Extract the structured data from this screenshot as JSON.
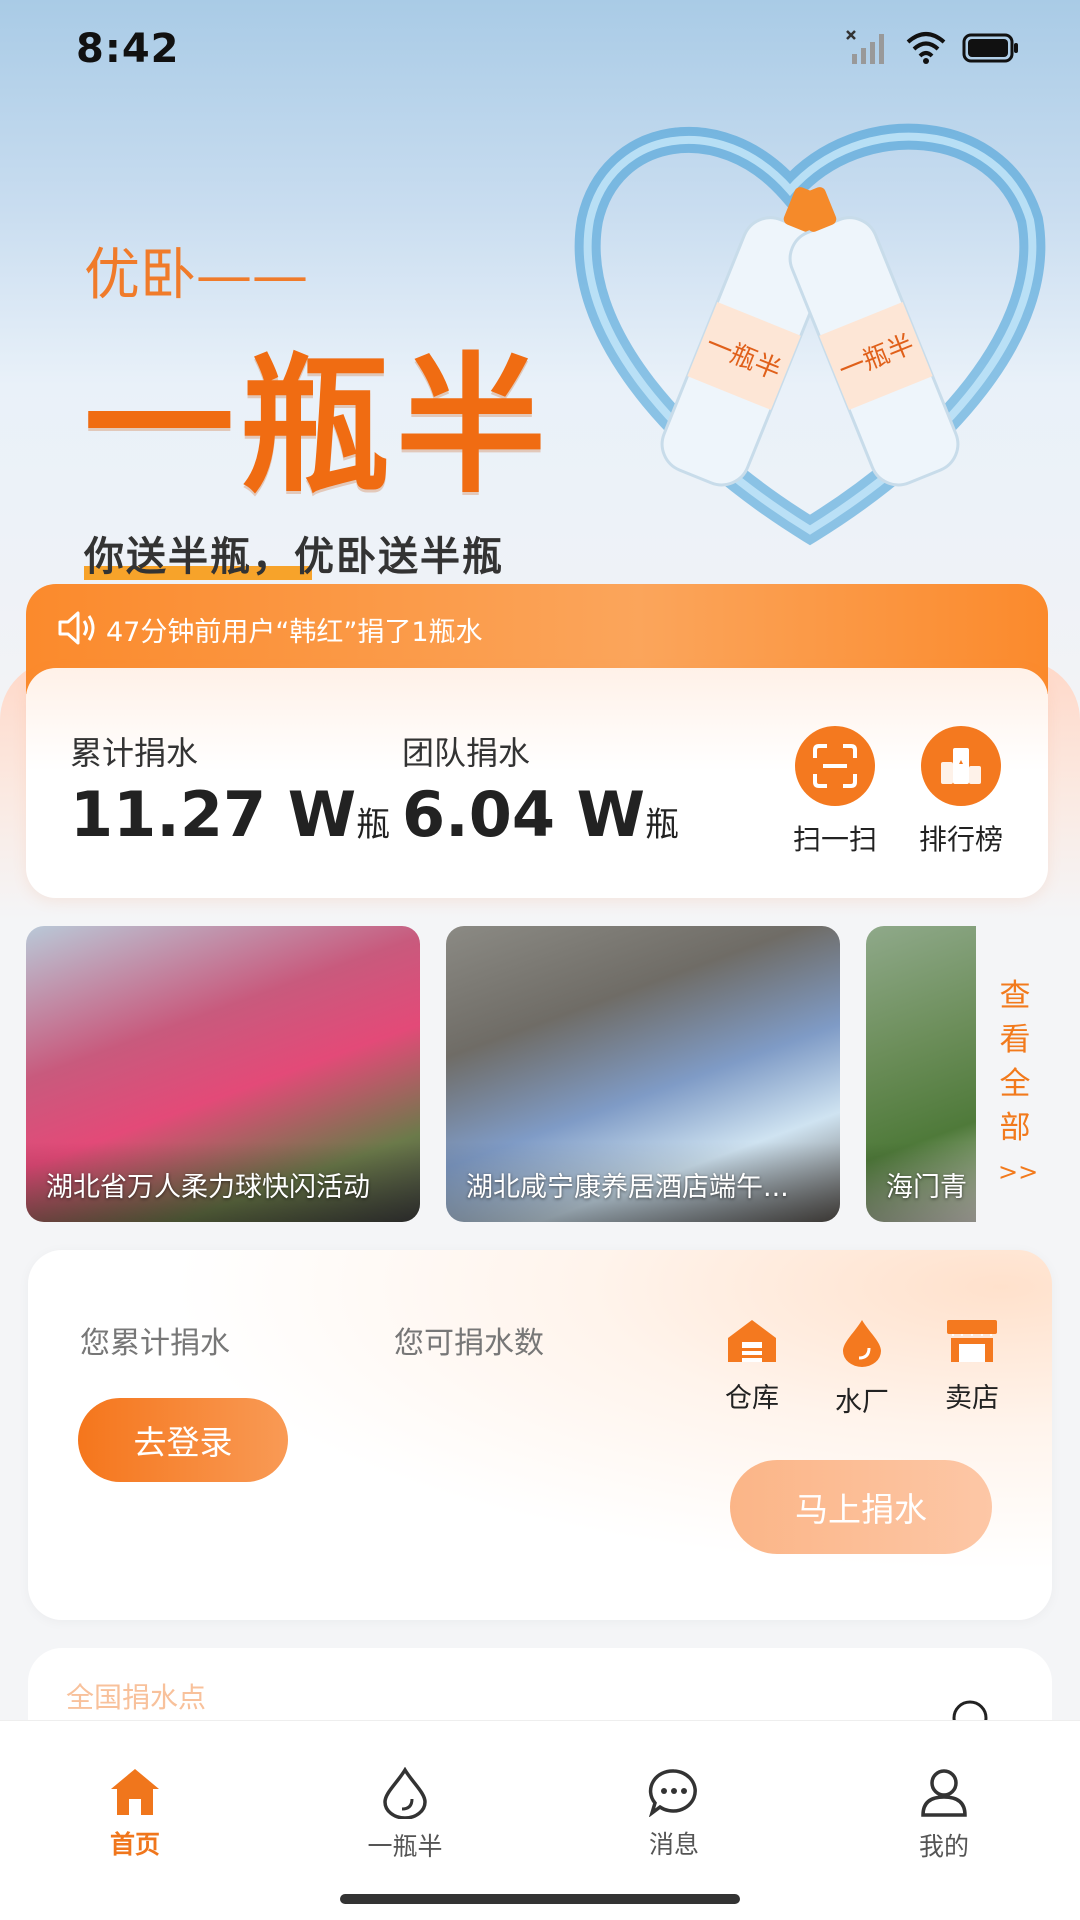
{
  "status_bar": {
    "time": "8:42"
  },
  "hero": {
    "subtitle": "优卧——",
    "title": "一瓶半",
    "slogan": "你送半瓶，优卧送半瓶",
    "bottle_label": "一瓶半"
  },
  "notice": {
    "text": "47分钟前用户“韩红”捐了1瓶水"
  },
  "stats": {
    "total": {
      "label": "累计捐水",
      "value": "11.27",
      "unit_w": "W",
      "unit": "瓶"
    },
    "team": {
      "label": "团队捐水",
      "value": "6.04",
      "unit_w": "W",
      "unit": "瓶"
    },
    "scan_label": "扫一扫",
    "rank_label": "排行榜"
  },
  "activities": {
    "items": [
      {
        "caption": "湖北省万人柔力球快闪活动"
      },
      {
        "caption": "湖北咸宁康养居酒店端午..."
      },
      {
        "caption": "海门青"
      }
    ],
    "view_all": [
      "查",
      "看",
      "全",
      "部",
      ">>"
    ]
  },
  "my_donation": {
    "my_total_label": "您累计捐水",
    "available_label": "您可捐水数",
    "login_button": "去登录",
    "warehouse_label": "仓库",
    "factory_label": "水厂",
    "store_label": "卖店",
    "donate_button": "马上捐水"
  },
  "national": {
    "title": "全国捐水点"
  },
  "tabbar": {
    "items": [
      {
        "label": "首页"
      },
      {
        "label": "一瓶半"
      },
      {
        "label": "消息"
      },
      {
        "label": "我的"
      }
    ]
  },
  "colors": {
    "accent": "#f4791f",
    "notice_bg": "#fb8a2c",
    "hero_sky": "#a9cbe6"
  }
}
